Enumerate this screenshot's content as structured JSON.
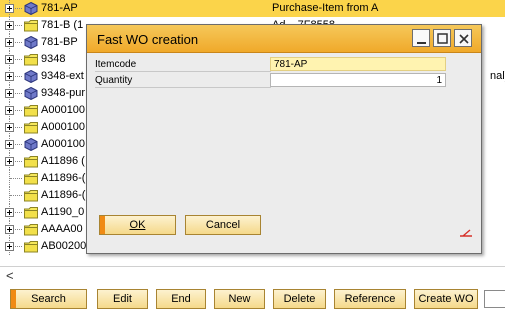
{
  "tree": {
    "rows": [
      {
        "label": "781-AP",
        "col2": "Purchase-Item from A",
        "icon": "cube-icon",
        "selected": true
      },
      {
        "label": "781-B (1",
        "col2": "Ad...   7F8558",
        "icon": "folder-icon",
        "selected": false
      },
      {
        "label": "781-BP",
        "col2": "",
        "icon": "cube-icon",
        "selected": false
      },
      {
        "label": "9348",
        "col2": "",
        "icon": "folder-icon",
        "selected": false
      },
      {
        "label": "9348-ext",
        "col2": "",
        "icon": "cube-icon",
        "selected": false
      },
      {
        "label": "9348-pur",
        "col2": "",
        "icon": "cube-icon",
        "selected": false
      },
      {
        "label": "A000100",
        "col2": "",
        "icon": "folder-icon",
        "selected": false
      },
      {
        "label": "A000100",
        "col2": "",
        "icon": "folder-icon",
        "selected": false
      },
      {
        "label": "A000100",
        "col2": "",
        "icon": "cube-icon",
        "selected": false
      },
      {
        "label": "A11896 (",
        "col2": "",
        "icon": "folder-icon",
        "selected": false
      },
      {
        "label": "A11896-(",
        "col2": "",
        "icon": "folder-icon",
        "selected": false
      },
      {
        "label": "A11896-(",
        "col2": "",
        "icon": "folder-icon",
        "selected": false
      },
      {
        "label": "A1190_0",
        "col2": "",
        "icon": "folder-icon",
        "selected": false
      },
      {
        "label": "AAAA00",
        "col2": "",
        "icon": "folder-icon",
        "selected": false
      },
      {
        "label": "AB00200",
        "col2": "",
        "icon": "folder-icon",
        "selected": false
      }
    ],
    "right_fragment": "nal)"
  },
  "dialog": {
    "title": "Fast WO creation",
    "fields": [
      {
        "label": "Itemcode",
        "value": "781-AP"
      },
      {
        "label": "Quantity",
        "value": "1"
      }
    ],
    "ok_label": "OK",
    "cancel_label": "Cancel"
  },
  "bottom": {
    "scroll_left": "<",
    "buttons": [
      "Search",
      "Edit",
      "End",
      "New",
      "Delete",
      "Reference",
      "Create WO"
    ]
  },
  "colors": {
    "selection": "#fbd44a",
    "accent": "#f08a13",
    "titlebar": "#f0a92a",
    "field_highlight": "#fff3b0"
  }
}
